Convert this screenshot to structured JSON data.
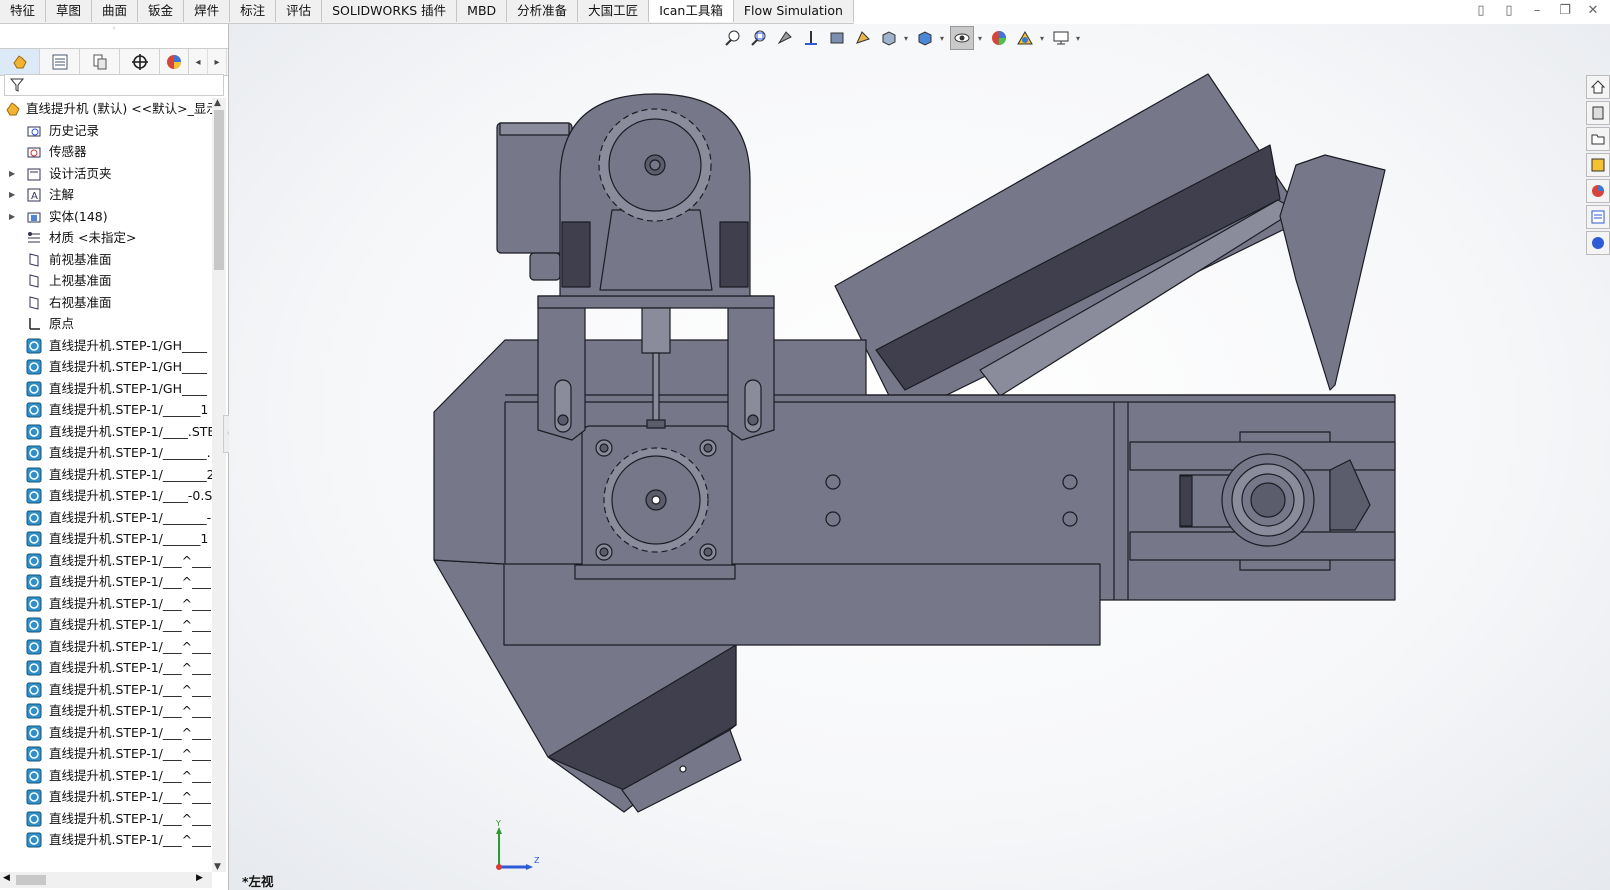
{
  "command_tabs": [
    "特征",
    "草图",
    "曲面",
    "钣金",
    "焊件",
    "标注",
    "评估",
    "SOLIDWORKS 插件",
    "MBD",
    "分析准备",
    "大国工匠",
    "Ican工具箱",
    "Flow Simulation"
  ],
  "feature_tree": {
    "root": "直线提升机 (默认) <<默认>_显示",
    "items": [
      {
        "label": "历史记录",
        "icon": "history-folder-icon",
        "expandable": false
      },
      {
        "label": "传感器",
        "icon": "sensor-icon",
        "expandable": false
      },
      {
        "label": "设计活页夹",
        "icon": "design-binder-icon",
        "expandable": true
      },
      {
        "label": "注解",
        "icon": "annotation-icon",
        "expandable": true
      },
      {
        "label": "实体(148)",
        "icon": "solid-bodies-icon",
        "expandable": true
      },
      {
        "label": "材质 <未指定>",
        "icon": "material-icon",
        "expandable": false
      },
      {
        "label": "前视基准面",
        "icon": "plane-icon",
        "expandable": false
      },
      {
        "label": "上视基准面",
        "icon": "plane-icon",
        "expandable": false
      },
      {
        "label": "右视基准面",
        "icon": "plane-icon",
        "expandable": false
      },
      {
        "label": "原点",
        "icon": "origin-icon",
        "expandable": false
      },
      {
        "label": "直线提升机.STEP-1/GH____",
        "icon": "body-icon",
        "expandable": false
      },
      {
        "label": "直线提升机.STEP-1/GH____",
        "icon": "body-icon",
        "expandable": false
      },
      {
        "label": "直线提升机.STEP-1/GH____",
        "icon": "body-icon",
        "expandable": false
      },
      {
        "label": "直线提升机.STEP-1/______1",
        "icon": "body-icon",
        "expandable": false
      },
      {
        "label": "直线提升机.STEP-1/____.STE",
        "icon": "body-icon",
        "expandable": false
      },
      {
        "label": "直线提升机.STEP-1/_______.",
        "icon": "body-icon",
        "expandable": false
      },
      {
        "label": "直线提升机.STEP-1/_______2",
        "icon": "body-icon",
        "expandable": false
      },
      {
        "label": "直线提升机.STEP-1/____-0.S",
        "icon": "body-icon",
        "expandable": false
      },
      {
        "label": "直线提升机.STEP-1/_______-",
        "icon": "body-icon",
        "expandable": false
      },
      {
        "label": "直线提升机.STEP-1/______1",
        "icon": "body-icon",
        "expandable": false
      },
      {
        "label": "直线提升机.STEP-1/___^___",
        "icon": "body-icon",
        "expandable": false
      },
      {
        "label": "直线提升机.STEP-1/___^___",
        "icon": "body-icon",
        "expandable": false
      },
      {
        "label": "直线提升机.STEP-1/___^___",
        "icon": "body-icon",
        "expandable": false
      },
      {
        "label": "直线提升机.STEP-1/___^___",
        "icon": "body-icon",
        "expandable": false
      },
      {
        "label": "直线提升机.STEP-1/___^___",
        "icon": "body-icon",
        "expandable": false
      },
      {
        "label": "直线提升机.STEP-1/___^___",
        "icon": "body-icon",
        "expandable": false
      },
      {
        "label": "直线提升机.STEP-1/___^___",
        "icon": "body-icon",
        "expandable": false
      },
      {
        "label": "直线提升机.STEP-1/___^___",
        "icon": "body-icon",
        "expandable": false
      },
      {
        "label": "直线提升机.STEP-1/___^___",
        "icon": "body-icon",
        "expandable": false
      },
      {
        "label": "直线提升机.STEP-1/___^___",
        "icon": "body-icon",
        "expandable": false
      },
      {
        "label": "直线提升机.STEP-1/___^___",
        "icon": "body-icon",
        "expandable": false
      },
      {
        "label": "直线提升机.STEP-1/___^___",
        "icon": "body-icon",
        "expandable": false
      },
      {
        "label": "直线提升机.STEP-1/___^___",
        "icon": "body-icon",
        "expandable": false
      },
      {
        "label": "直线提升机.STEP-1/___^___",
        "icon": "body-icon",
        "expandable": false
      }
    ]
  },
  "viewport": {
    "view_name": "*左视",
    "triad": {
      "y_label": "Y",
      "z_label": "Z"
    }
  },
  "colors": {
    "model_face": "#767889",
    "model_dark": "#3f3f4e",
    "model_edge": "#1c1c24",
    "selected_tab": "#dce9f7"
  }
}
